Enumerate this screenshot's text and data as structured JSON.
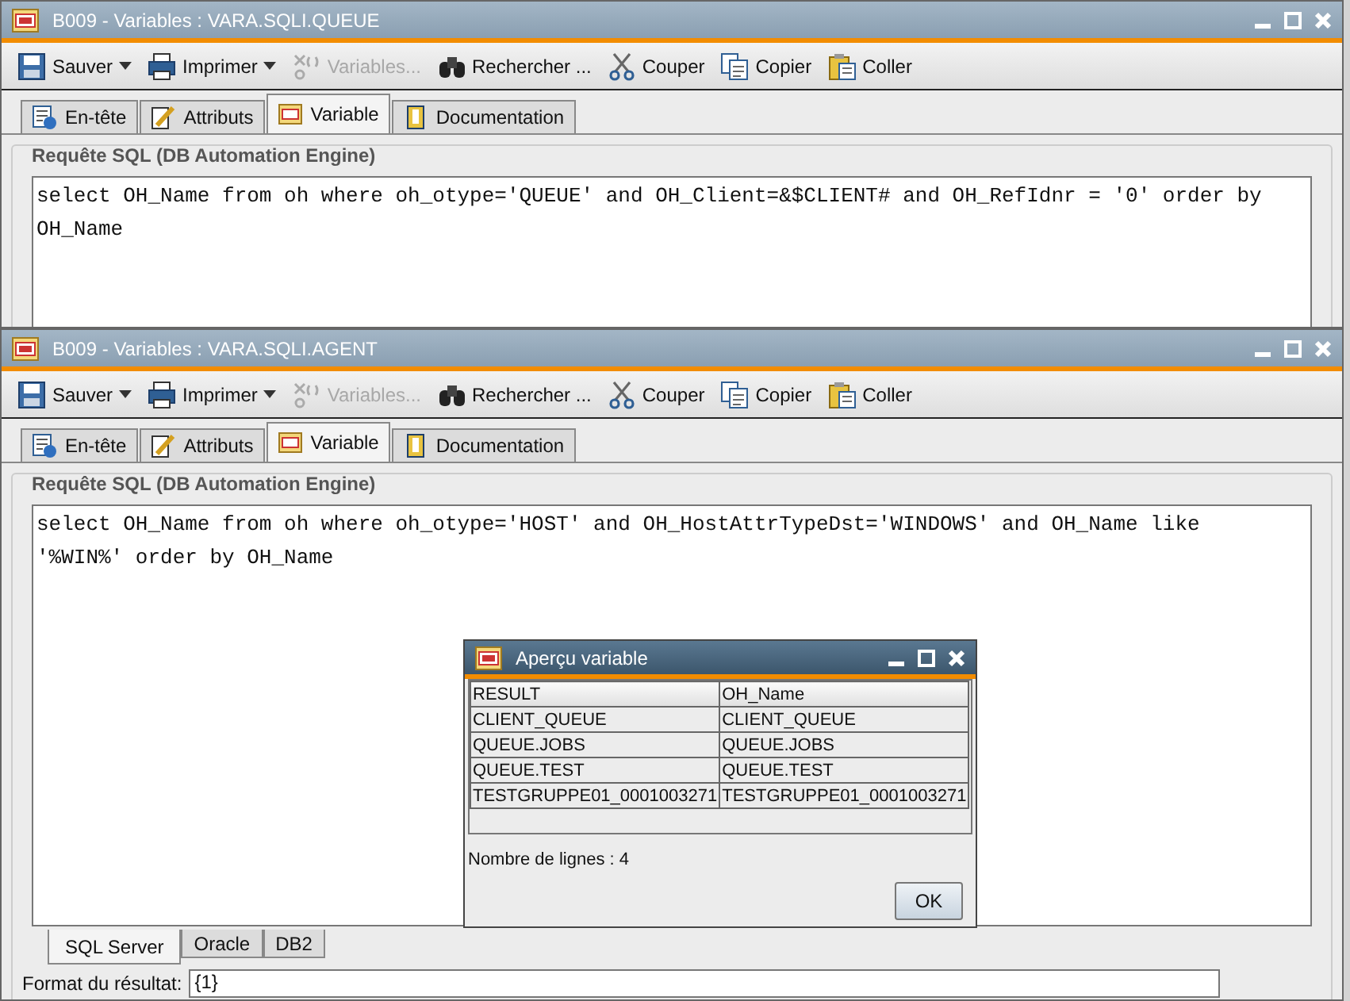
{
  "windows": [
    {
      "title": "B009 - Variables : VARA.SQLI.QUEUE",
      "toolbar": [
        {
          "label": "Sauver",
          "kind": "save",
          "dropdown": true,
          "disabled": false
        },
        {
          "label": "Imprimer",
          "kind": "print",
          "dropdown": true,
          "disabled": false
        },
        {
          "label": "Variables...",
          "kind": "variables",
          "dropdown": false,
          "disabled": true
        },
        {
          "label": "Rechercher ...",
          "kind": "find",
          "dropdown": false,
          "disabled": false
        },
        {
          "label": "Couper",
          "kind": "cut",
          "dropdown": false,
          "disabled": false
        },
        {
          "label": "Copier",
          "kind": "copy",
          "dropdown": false,
          "disabled": false
        },
        {
          "label": "Coller",
          "kind": "paste",
          "dropdown": false,
          "disabled": false
        }
      ],
      "tabs": [
        {
          "label": "En-tête",
          "kind": "header",
          "selected": false
        },
        {
          "label": "Attributs",
          "kind": "attributes",
          "selected": false
        },
        {
          "label": "Variable",
          "kind": "variable",
          "selected": true
        },
        {
          "label": "Documentation",
          "kind": "doc",
          "selected": false
        }
      ],
      "group_title": "Requête SQL (DB Automation Engine)",
      "sql": "select OH_Name from oh where oh_otype='QUEUE' and OH_Client=&$CLIENT# and OH_RefIdnr = '0' order by OH_Name"
    },
    {
      "title": "B009 - Variables : VARA.SQLI.AGENT",
      "toolbar": [
        {
          "label": "Sauver",
          "kind": "save",
          "dropdown": true,
          "disabled": false
        },
        {
          "label": "Imprimer",
          "kind": "print",
          "dropdown": true,
          "disabled": false
        },
        {
          "label": "Variables...",
          "kind": "variables",
          "dropdown": false,
          "disabled": true
        },
        {
          "label": "Rechercher ...",
          "kind": "find",
          "dropdown": false,
          "disabled": false
        },
        {
          "label": "Couper",
          "kind": "cut",
          "dropdown": false,
          "disabled": false
        },
        {
          "label": "Copier",
          "kind": "copy",
          "dropdown": false,
          "disabled": false
        },
        {
          "label": "Coller",
          "kind": "paste",
          "dropdown": false,
          "disabled": false
        }
      ],
      "tabs": [
        {
          "label": "En-tête",
          "kind": "header",
          "selected": false
        },
        {
          "label": "Attributs",
          "kind": "attributes",
          "selected": false
        },
        {
          "label": "Variable",
          "kind": "variable",
          "selected": true
        },
        {
          "label": "Documentation",
          "kind": "doc",
          "selected": false
        }
      ],
      "group_title": "Requête SQL (DB Automation Engine)",
      "sql": "select OH_Name from oh where oh_otype='HOST' and OH_HostAttrTypeDst='WINDOWS' and OH_Name like '%WIN%' order by OH_Name",
      "db_tabs": [
        {
          "label": "SQL Server",
          "selected": true
        },
        {
          "label": "Oracle",
          "selected": false
        },
        {
          "label": "DB2",
          "selected": false
        }
      ],
      "result_format": {
        "label": "Format du résultat:",
        "value": "{1}"
      }
    }
  ],
  "dialog": {
    "title": "Aperçu variable",
    "columns": [
      "RESULT",
      "OH_Name"
    ],
    "rows": [
      [
        "CLIENT_QUEUE",
        "CLIENT_QUEUE"
      ],
      [
        "QUEUE.JOBS",
        "QUEUE.JOBS"
      ],
      [
        "QUEUE.TEST",
        "QUEUE.TEST"
      ],
      [
        "TESTGRUPPE01_0001003271",
        "TESTGRUPPE01_0001003271"
      ]
    ],
    "row_count": "Nombre de lignes : 4",
    "button": "OK"
  }
}
